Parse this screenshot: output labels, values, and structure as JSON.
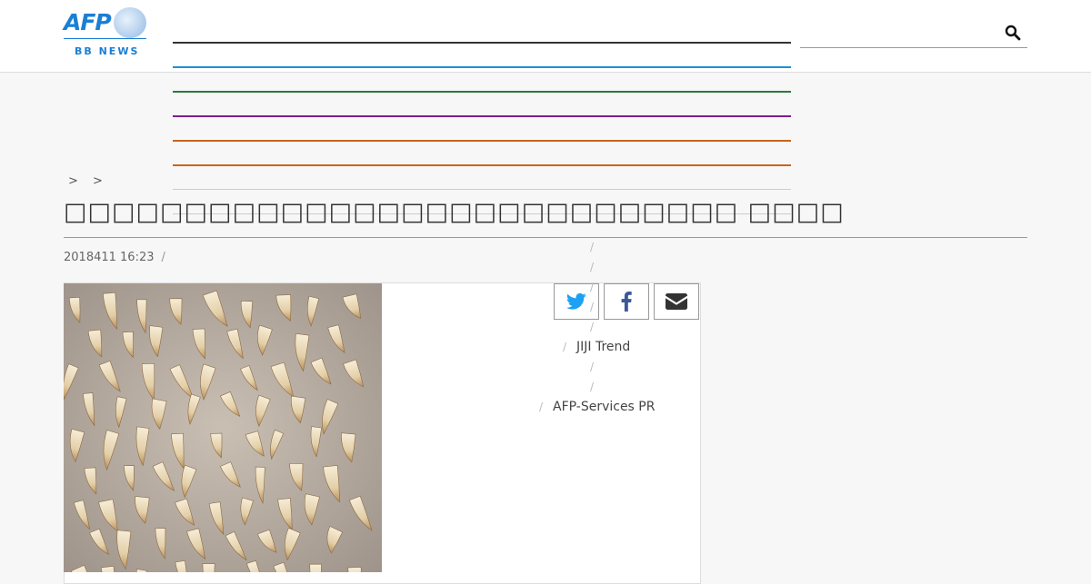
{
  "header": {
    "logo_text": "AFP",
    "logo_subtitle": "BB NEWS",
    "search_icon": "search-icon"
  },
  "nav": {
    "line_colors": [
      "#333333",
      "#1a8fd4",
      "#2a7a3a",
      "#7a1f8a",
      "#c8651a",
      "#c8651a",
      "#cccccc",
      "#cccccc"
    ]
  },
  "breadcrumb": {
    "text": "> >"
  },
  "article": {
    "title": "□□□□□□□□□□□□□□□□□□□□□□□□□□□□ □□□□",
    "date": "2018411 16:23",
    "separator": "/",
    "photo_icon": "photo-crocodile-teeth"
  },
  "share": {
    "twitter_icon": "twitter-icon",
    "facebook_icon": "facebook-icon",
    "email_icon": "email-icon"
  },
  "sidebar": {
    "separator": "/",
    "items": [
      {
        "label": "JIJI Trend"
      },
      {
        "label": "AFP-Services PR"
      }
    ]
  },
  "colors": {
    "brand": "#1a7fd4",
    "background": "#f7f7f7"
  }
}
